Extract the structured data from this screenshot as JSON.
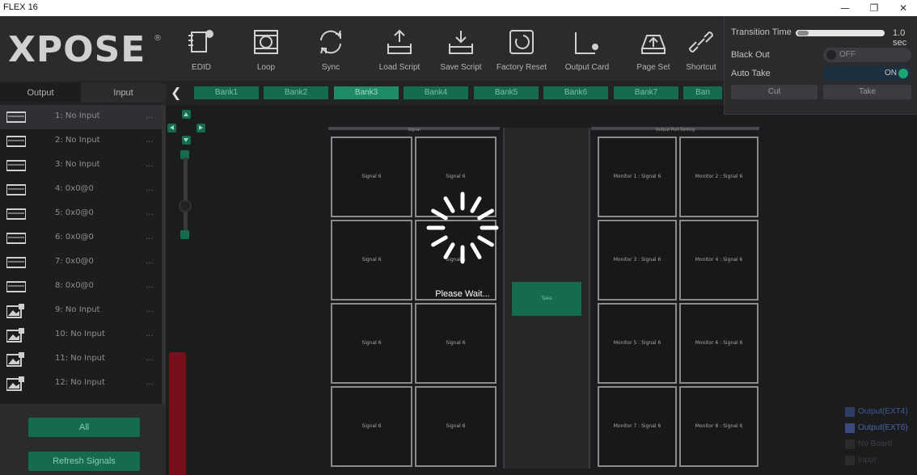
{
  "window": {
    "title": "FLEX 16",
    "minimize": "—",
    "restore": "❐",
    "close": "✕"
  },
  "logo": {
    "text": "XPOSE",
    "reg": "®"
  },
  "toolbar": {
    "items": [
      {
        "label": "EDID",
        "icon": "edid-icon"
      },
      {
        "label": "Loop",
        "icon": "loop-icon"
      },
      {
        "label": "Sync",
        "icon": "sync-icon"
      },
      {
        "label": "Load Script",
        "icon": "load-script-icon"
      },
      {
        "label": "Save Script",
        "icon": "save-script-icon"
      },
      {
        "label": "Factory Reset",
        "icon": "factory-reset-icon"
      },
      {
        "label": "Output Card",
        "icon": "output-card-icon"
      },
      {
        "label": "Page Set",
        "icon": "page-set-icon"
      },
      {
        "label": "Shortcut",
        "icon": "shortcut-icon"
      }
    ]
  },
  "tabs": {
    "output": "Output",
    "input": "Input"
  },
  "sidebar": {
    "items": [
      {
        "label": "1: No Input",
        "dots": "...",
        "icon": "monitor-icon"
      },
      {
        "label": "2: No Input",
        "dots": "...",
        "icon": "monitor-icon"
      },
      {
        "label": "3: No Input",
        "dots": "...",
        "icon": "monitor-icon"
      },
      {
        "label": "4: 0x0@0",
        "dots": "...",
        "icon": "monitor-icon"
      },
      {
        "label": "5: 0x0@0",
        "dots": "...",
        "icon": "monitor-icon"
      },
      {
        "label": "6: 0x0@0",
        "dots": "...",
        "icon": "monitor-icon"
      },
      {
        "label": "7: 0x0@0",
        "dots": "...",
        "icon": "monitor-icon"
      },
      {
        "label": "8: 0x0@0",
        "dots": "...",
        "icon": "monitor-icon"
      },
      {
        "label": "9: No Input",
        "dots": "...",
        "icon": "image-icon"
      },
      {
        "label": "10: No Input",
        "dots": "...",
        "icon": "image-icon"
      },
      {
        "label": "11: No Input",
        "dots": "...",
        "icon": "image-icon"
      },
      {
        "label": "12: No Input",
        "dots": "...",
        "icon": "image-icon"
      }
    ],
    "all_label": "All",
    "refresh_label": "Refresh Signals"
  },
  "banks": [
    "Bank1",
    "Bank2",
    "Bank3",
    "Bank4",
    "Bank5",
    "Bank6",
    "Bank7",
    "Ban"
  ],
  "signal_panel": {
    "header": "Signal",
    "cells": [
      "Signal 6",
      "Signal 6",
      "Signal 6",
      "Signal 6",
      "Signal 6",
      "Signal 6",
      "Signal 6",
      "Signal 6"
    ]
  },
  "output_panel": {
    "header": "Output Port  Setting",
    "cells": [
      "Monitor  1 : Signal 6",
      "Monitor  2 : Signal 6",
      "Monitor  3 : Signal 6",
      "Monitor  4 : Signal 6",
      "Monitor  5 : Signal 6",
      "Monitor  6 : Signal 6",
      "Monitor  7 : Signal 6",
      "Monitor  8 : Signal 6"
    ]
  },
  "take_label": "Take",
  "loading": {
    "text": "Please Wait..."
  },
  "overlay": {
    "transition_label": "Transition Time",
    "transition_value": "1.0 sec",
    "blackout_label": "Black Out",
    "blackout_state": "OFF",
    "autotake_label": "Auto Take",
    "autotake_state": "ON",
    "cut_label": "Cut",
    "take_label": "Take"
  },
  "legend": [
    {
      "label": "Output(EXT4)",
      "color": "#2c3e66"
    },
    {
      "label": "Output(EXT6)",
      "color": "#3a4a7c"
    },
    {
      "label": "No Board",
      "color": "#2a2b2d"
    },
    {
      "label": "Input",
      "color": "#2a2b2d"
    }
  ],
  "colors": {
    "accent": "#156b50",
    "danger": "#7a0f1c"
  }
}
